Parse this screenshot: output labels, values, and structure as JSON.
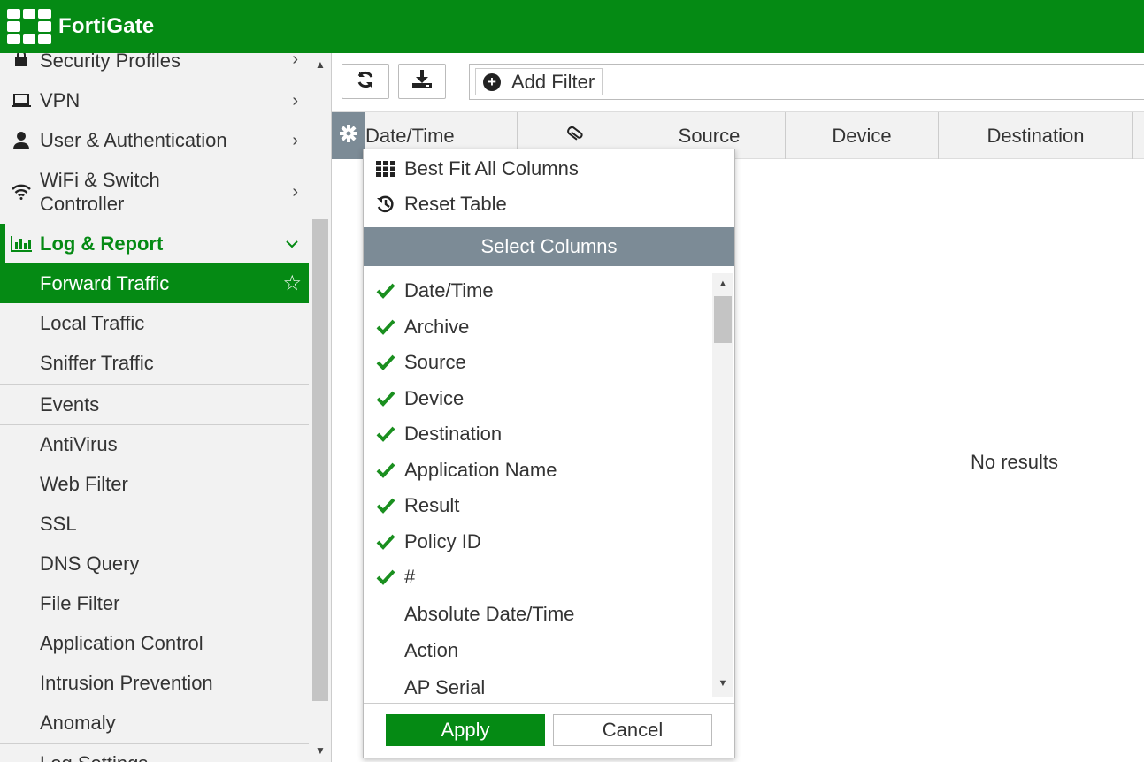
{
  "header": {
    "brand": "FortiGate"
  },
  "sidebar": {
    "items": [
      {
        "label": "Security Profiles",
        "icon": "lock-icon",
        "chevron": "›"
      },
      {
        "label": "VPN",
        "icon": "laptop-icon",
        "chevron": "›"
      },
      {
        "label": "User & Authentication",
        "icon": "user-icon",
        "chevron": "›"
      },
      {
        "label": "WiFi & Switch Controller",
        "icon": "wifi-icon",
        "chevron": "›"
      },
      {
        "label": "Log & Report",
        "icon": "bar-chart-icon",
        "chevron": "⌄"
      },
      {
        "label": "Forward Traffic"
      },
      {
        "label": "Local Traffic"
      },
      {
        "label": "Sniffer Traffic"
      },
      {
        "label": "Events"
      },
      {
        "label": "AntiVirus"
      },
      {
        "label": "Web Filter"
      },
      {
        "label": "SSL"
      },
      {
        "label": "DNS Query"
      },
      {
        "label": "File Filter"
      },
      {
        "label": "Application Control"
      },
      {
        "label": "Intrusion Prevention"
      },
      {
        "label": "Anomaly"
      },
      {
        "label": "Log Settings"
      }
    ],
    "wifi_line1": "WiFi & Switch",
    "wifi_line2": "Controller"
  },
  "toolbar": {
    "refresh_icon": "refresh-icon",
    "download_icon": "download-icon",
    "add_filter_label": "Add Filter"
  },
  "table": {
    "columns": [
      "Date/Time",
      "",
      "Source",
      "Device",
      "Destination"
    ],
    "attachment_icon": "paperclip-icon",
    "empty_text": "No results"
  },
  "dropdown": {
    "best_fit_label": "Best Fit All Columns",
    "reset_label": "Reset Table",
    "section_title": "Select Columns",
    "columns": [
      {
        "label": "Date/Time",
        "checked": true
      },
      {
        "label": "Archive",
        "checked": true
      },
      {
        "label": "Source",
        "checked": true
      },
      {
        "label": "Device",
        "checked": true
      },
      {
        "label": "Destination",
        "checked": true
      },
      {
        "label": "Application Name",
        "checked": true
      },
      {
        "label": "Result",
        "checked": true
      },
      {
        "label": "Policy ID",
        "checked": true
      },
      {
        "label": "#",
        "checked": true
      },
      {
        "label": "Absolute Date/Time",
        "checked": false
      },
      {
        "label": "Action",
        "checked": false
      },
      {
        "label": "AP Serial",
        "checked": false
      }
    ],
    "apply_label": "Apply",
    "cancel_label": "Cancel"
  },
  "colors": {
    "brand_green": "#058a14",
    "slate": "#7c8b96"
  }
}
